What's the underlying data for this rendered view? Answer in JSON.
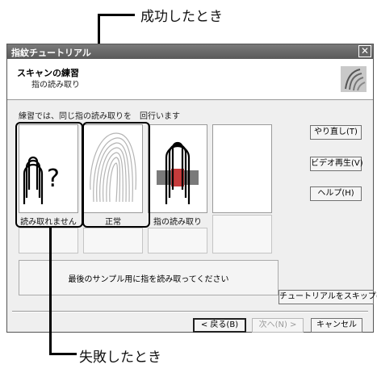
{
  "callouts": {
    "success": "成功したとき",
    "failure": "失敗したとき"
  },
  "window": {
    "title": "指紋チュートリアル",
    "close_glyph": "✕",
    "header_title": "スキャンの練習",
    "header_subtitle": "指の読み取り",
    "instruction": "練習では、同じ指の読み取りを　回行います",
    "tiles": [
      {
        "label": "読み取れません",
        "state": "failure"
      },
      {
        "label": "正常",
        "state": "success"
      },
      {
        "label": "指の読み取り",
        "state": "scanning"
      },
      {
        "label": "",
        "state": "empty"
      }
    ],
    "side_buttons": {
      "retry": "やり直し(T)",
      "play_video": "ビデオ再生(V)",
      "help": "ヘルプ(H)"
    },
    "message": "最後のサンプル用に指を読み取ってください",
    "skip_button": "チュートリアルをスキップ(S)",
    "nav": {
      "back": "< 戻る(B)",
      "next": "次へ(N) >",
      "cancel": "キャンセル"
    }
  }
}
